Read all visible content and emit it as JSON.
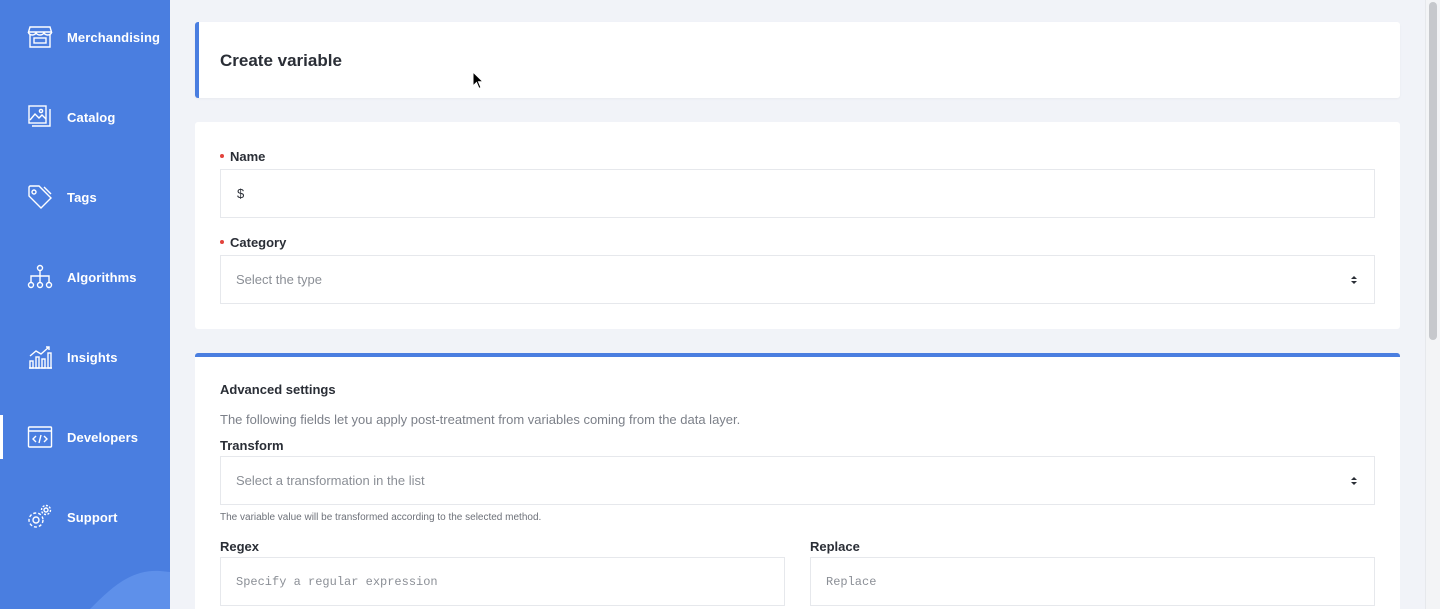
{
  "sidebar": {
    "items": [
      {
        "label": "Merchandising",
        "icon": "store-icon",
        "active": false
      },
      {
        "label": "Catalog",
        "icon": "image-stack-icon",
        "active": false
      },
      {
        "label": "Tags",
        "icon": "tag-icon",
        "active": false
      },
      {
        "label": "Algorithms",
        "icon": "hierarchy-icon",
        "active": false
      },
      {
        "label": "Insights",
        "icon": "chart-icon",
        "active": false
      },
      {
        "label": "Developers",
        "icon": "code-icon",
        "active": true
      },
      {
        "label": "Support",
        "icon": "gears-icon",
        "active": false
      }
    ]
  },
  "header": {
    "title": "Create variable"
  },
  "form": {
    "name": {
      "label": "Name",
      "value": "$",
      "required": true
    },
    "category": {
      "label": "Category",
      "placeholder": "Select the type",
      "required": true
    }
  },
  "advanced": {
    "title": "Advanced settings",
    "description": "The following fields let you apply post-treatment from variables coming from the data layer.",
    "transform": {
      "label": "Transform",
      "placeholder": "Select a transformation in the list",
      "helper": "The variable value will be transformed according to the selected method."
    },
    "regex": {
      "label": "Regex",
      "placeholder": "Specify a regular expression"
    },
    "replace": {
      "label": "Replace",
      "placeholder": "Replace"
    }
  },
  "colors": {
    "accent": "#4a7ee0",
    "required": "#e2433c",
    "background": "#f1f3f8"
  }
}
